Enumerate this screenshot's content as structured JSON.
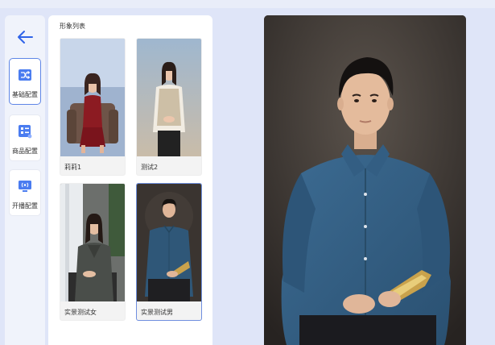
{
  "nav": {
    "back_label": "",
    "items": [
      {
        "label": "基础配置",
        "icon": "shuffle-config-icon",
        "active": true
      },
      {
        "label": "商品配置",
        "icon": "product-list-icon",
        "active": false
      },
      {
        "label": "开播配置",
        "icon": "broadcast-monitor-icon",
        "active": false
      }
    ]
  },
  "panel": {
    "title": "形象列表",
    "cards": [
      {
        "caption": "莉莉1",
        "selected": false
      },
      {
        "caption": "测试2",
        "selected": false
      },
      {
        "caption": "实景测试女",
        "selected": false
      },
      {
        "caption": "实景测试男",
        "selected": true
      }
    ]
  },
  "preview": {
    "label": ""
  },
  "colors": {
    "accent": "#4a7cf0",
    "selected_border": "#6f8fdf",
    "page_bg": "#dfe5f8"
  }
}
